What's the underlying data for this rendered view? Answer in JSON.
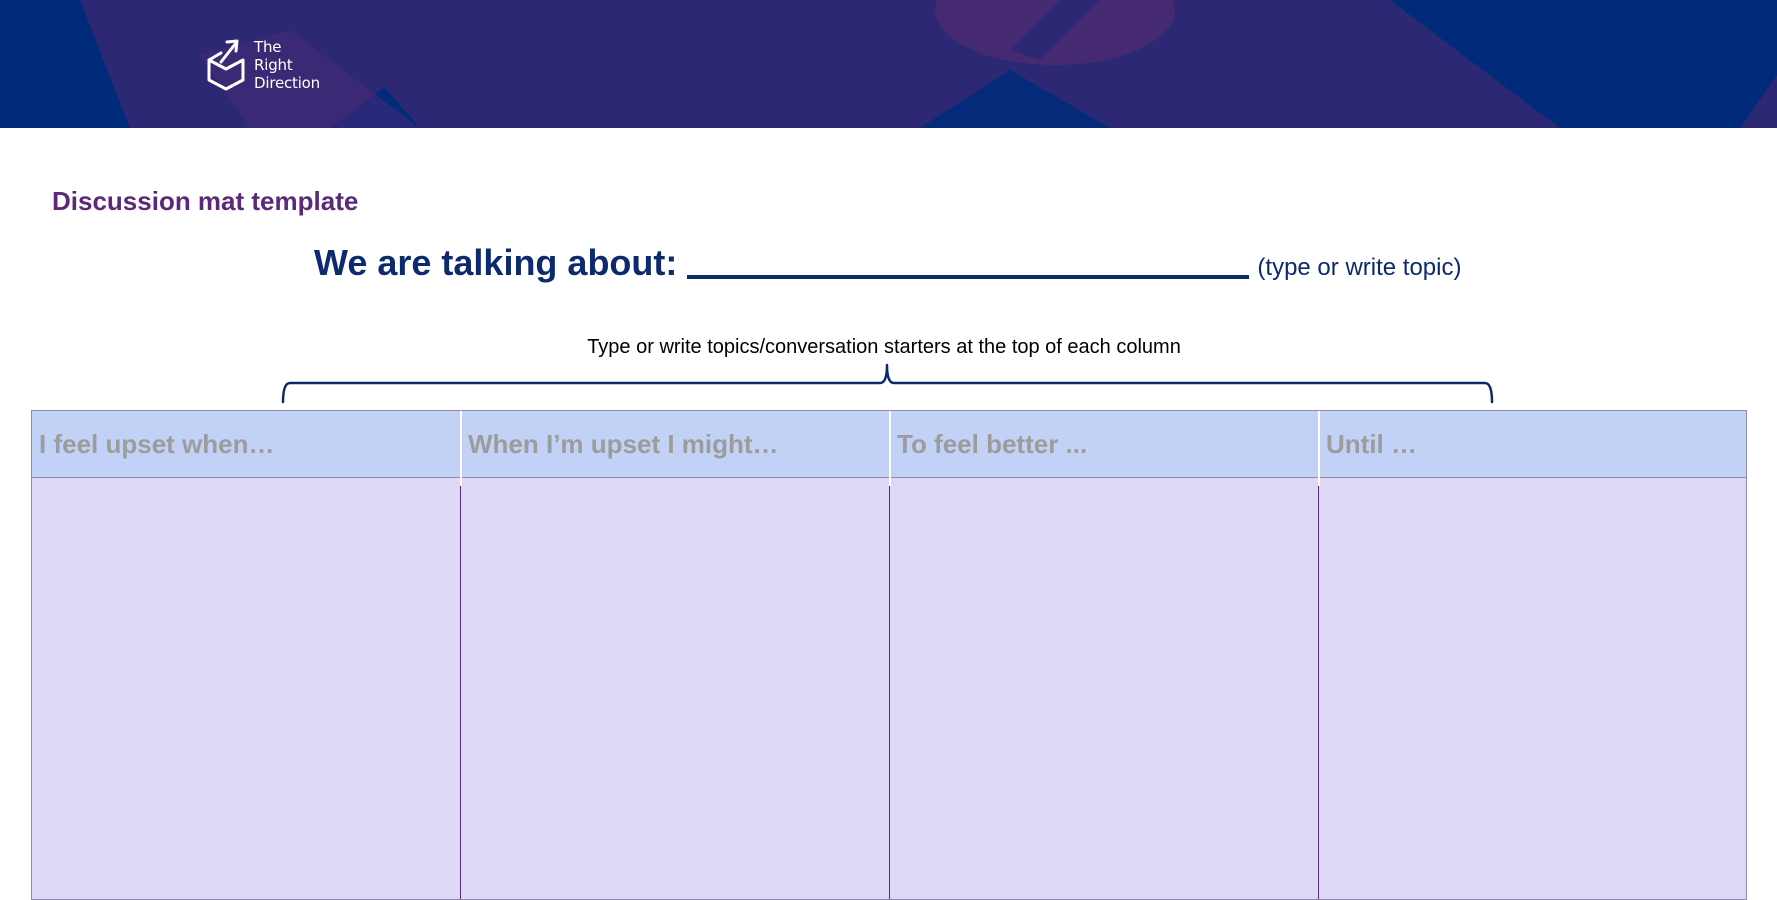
{
  "brand": {
    "logo_lines": [
      "The",
      "Right",
      "Direction"
    ],
    "colors": {
      "header_navy": "#002a7a",
      "header_purple": "#2d2873",
      "title_purple": "#5a2a78",
      "topic_navy": "#0d2a6e",
      "column_head_bg": "#c1d2f6",
      "column_body_bg": "#dcd8f5",
      "column_head_text": "#9c9c9c"
    },
    "logo_icon": "box-arrow-icon"
  },
  "document": {
    "title": "Discussion mat template",
    "topic_label": "We are talking about:",
    "topic_hint": "(type or write topic)",
    "instruction": "Type or write topics/conversation starters at the top of each column"
  },
  "columns": [
    {
      "heading": "I feel upset when…"
    },
    {
      "heading": "When I’m upset I might…"
    },
    {
      "heading": "To feel better ..."
    },
    {
      "heading": "Until …"
    }
  ]
}
